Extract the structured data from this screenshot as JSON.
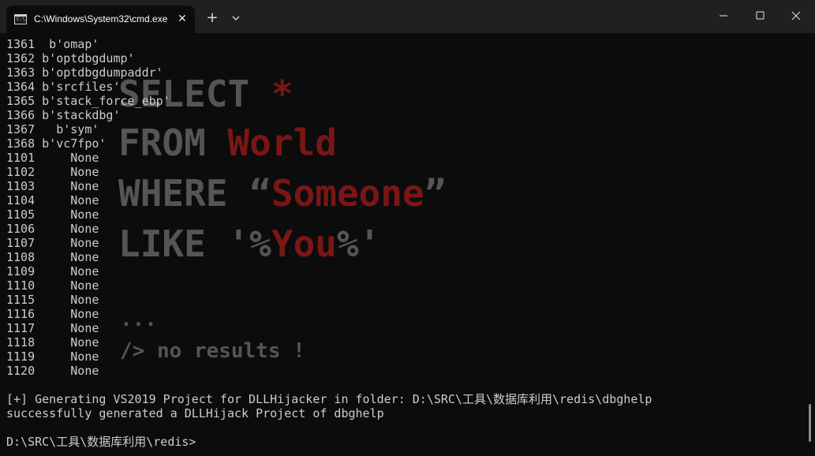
{
  "window": {
    "tab_title": "C:\\Windows\\System32\\cmd.exe",
    "tab_icon_text": "C:\\"
  },
  "icons": {
    "tab_icon": "cmd-icon",
    "close_tab": "close-icon",
    "new_tab": "plus-icon",
    "dropdown": "chevron-down-icon",
    "minimize": "minimize-icon",
    "maximize": "maximize-icon",
    "close_window": "close-icon"
  },
  "glyphs": {
    "close_tab": "✕",
    "new_tab": "+"
  },
  "background_art": {
    "line1_gray": "SELECT ",
    "line1_red": "*",
    "line2_gray": "FROM ",
    "line2_red": "World",
    "line3_gray": "WHERE “",
    "line3_red": "Someone",
    "line3_gray_end": "”",
    "line4_gray": "LIKE '%",
    "line4_red": "You",
    "line4_gray_end": "%'",
    "dots": "...",
    "no_results": "/> no results !"
  },
  "console": {
    "lines": [
      "1361  b'omap'",
      "1362 b'optdbgdump'",
      "1363 b'optdbgdumpaddr'",
      "1364 b'srcfiles'",
      "1365 b'stack_force_ebp'",
      "1366 b'stackdbg'",
      "1367   b'sym'",
      "1368 b'vc7fpo'",
      "1101     None",
      "1102     None",
      "1103     None",
      "1104     None",
      "1105     None",
      "1106     None",
      "1107     None",
      "1108     None",
      "1109     None",
      "1110     None",
      "1115     None",
      "1116     None",
      "1117     None",
      "1118     None",
      "1119     None",
      "1120     None",
      "",
      "[+] Generating VS2019 Project for DLLHijacker in folder: D:\\SRC\\工具\\数据库利用\\redis\\dbghelp",
      "successfully generated a DLLHijack Project of dbghelp",
      "",
      "D:\\SRC\\工具\\数据库利用\\redis>"
    ]
  },
  "colors": {
    "titlebar": "#202020",
    "console_bg": "#0c0c0c",
    "console_text": "#cccccc",
    "art_gray": "#555555",
    "art_red": "#7a1616"
  }
}
